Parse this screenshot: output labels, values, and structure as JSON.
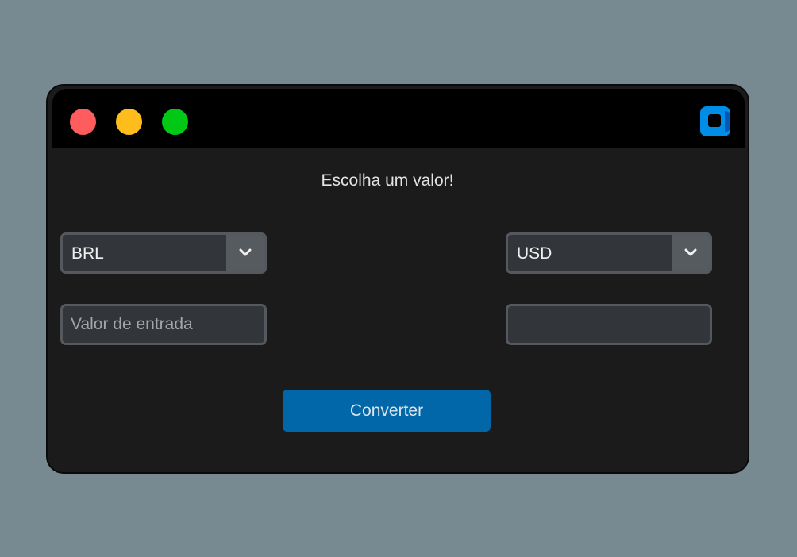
{
  "window": {
    "controls": {
      "close_color": "#ff5d5d",
      "minimize_color": "#ffbd1d",
      "maximize_color": "#00c814"
    },
    "app_icon": "square-app-icon"
  },
  "main": {
    "prompt": "Escolha um valor!",
    "from_currency": {
      "selected": "BRL",
      "icon": "chevron-down-icon"
    },
    "to_currency": {
      "selected": "USD",
      "icon": "chevron-down-icon"
    },
    "input_field": {
      "placeholder": "Valor de entrada",
      "value": ""
    },
    "output_field": {
      "value": ""
    },
    "convert_button": {
      "label": "Converter",
      "color": "#0167a8"
    }
  }
}
